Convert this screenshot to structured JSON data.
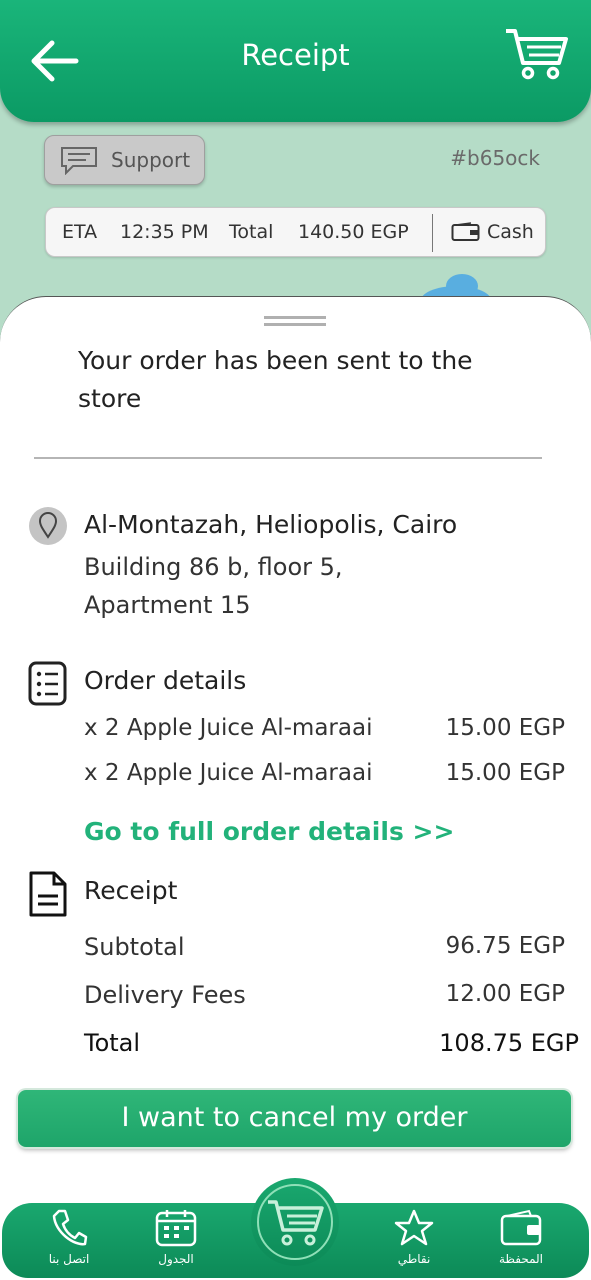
{
  "header": {
    "title": "Receipt"
  },
  "support": {
    "label": "Support"
  },
  "order_code": "#b65ock",
  "info": {
    "eta_label": "ETA",
    "eta_value": "12:35 PM",
    "total_label": "Total",
    "total_value": "140.50 EGP",
    "payment": "Cash"
  },
  "status_message": "Your order has been sent to the store",
  "address": {
    "title": "Al-Montazah, Heliopolis, Cairo",
    "line1": "Building 86 b, floor 5,",
    "line2": "Apartment 15"
  },
  "order": {
    "title": "Order details",
    "items": [
      {
        "name": "x 2 Apple Juice Al-maraai",
        "price": "15.00 EGP"
      },
      {
        "name": "x 2 Apple Juice Al-maraai",
        "price": "15.00 EGP"
      }
    ],
    "full_link": "Go to full order details >>"
  },
  "receipt": {
    "title": "Receipt",
    "subtotal_label": "Subtotal",
    "subtotal_value": "96.75 EGP",
    "delivery_label": "Delivery Fees",
    "delivery_value": "12.00 EGP",
    "total_label": "Total",
    "total_value": "108.75 EGP"
  },
  "cancel_button": "I want to cancel my order",
  "nav": {
    "contact": "اتصل بنا",
    "schedule": "الجدول",
    "points": "نقاطي",
    "wallet": "المحفظة"
  },
  "colors": {
    "brand_green": "#0b9a64",
    "link_green": "#22b27a"
  }
}
